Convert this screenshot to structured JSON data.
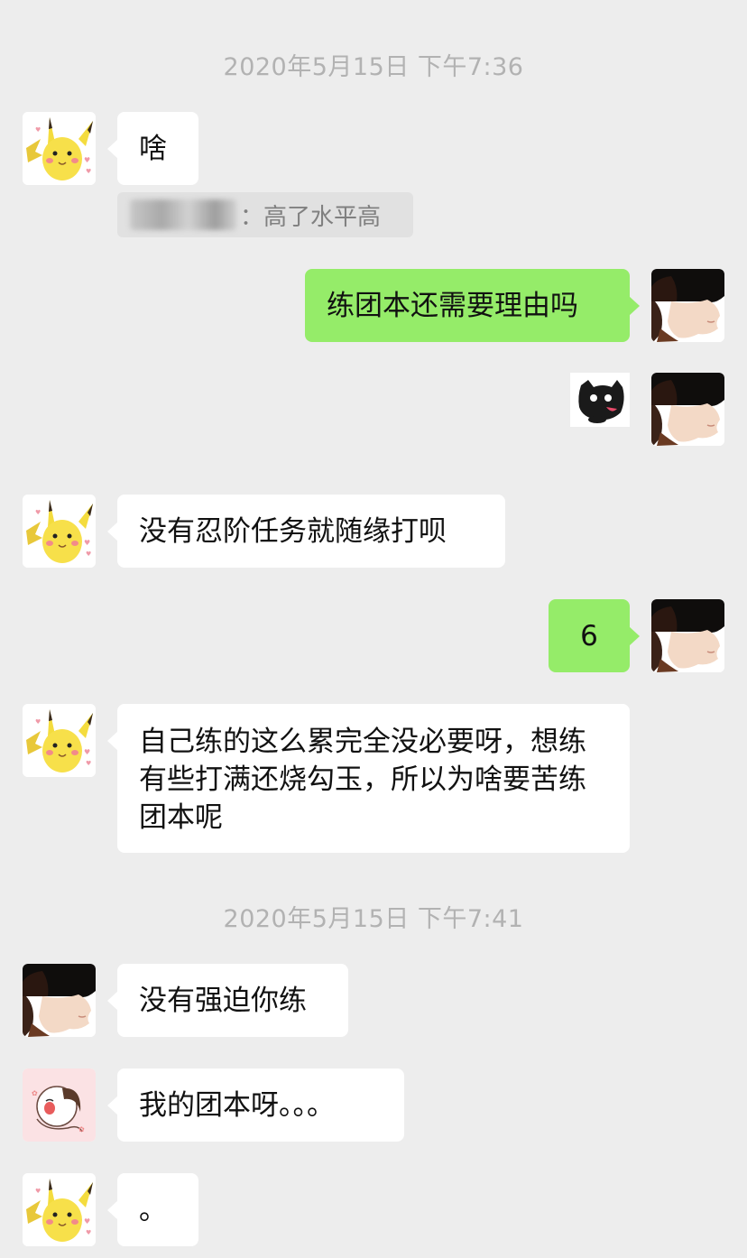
{
  "timestamps": [
    "2020年5月15日 下午7:36",
    "2020年5月15日 下午7:41"
  ],
  "messages": [
    {
      "text": "啥"
    },
    {
      "quote_separator": "：",
      "quote_text": "高了水平高"
    },
    {
      "text": "练团本还需要理由吗"
    },
    {
      "sticker": "black-cat-sticker"
    },
    {
      "text": "没有忍阶任务就随缘打呗"
    },
    {
      "text": "6"
    },
    {
      "text": "自己练的这么累完全没必要呀，想练有些打满还烧勾玉，所以为啥要苦练团本呢"
    },
    {
      "text": "没有强迫你练"
    },
    {
      "text": "我的团本呀。。。"
    },
    {
      "text": "。"
    }
  ],
  "avatars": {
    "pikachu": "pikachu-avatar",
    "self": "hat-person-avatar",
    "cartoon": "cartoon-girl-avatar"
  },
  "colors": {
    "background": "#ededed",
    "incoming_bubble": "#ffffff",
    "outgoing_bubble": "#95ec69",
    "timestamp": "#b2b2b2"
  }
}
